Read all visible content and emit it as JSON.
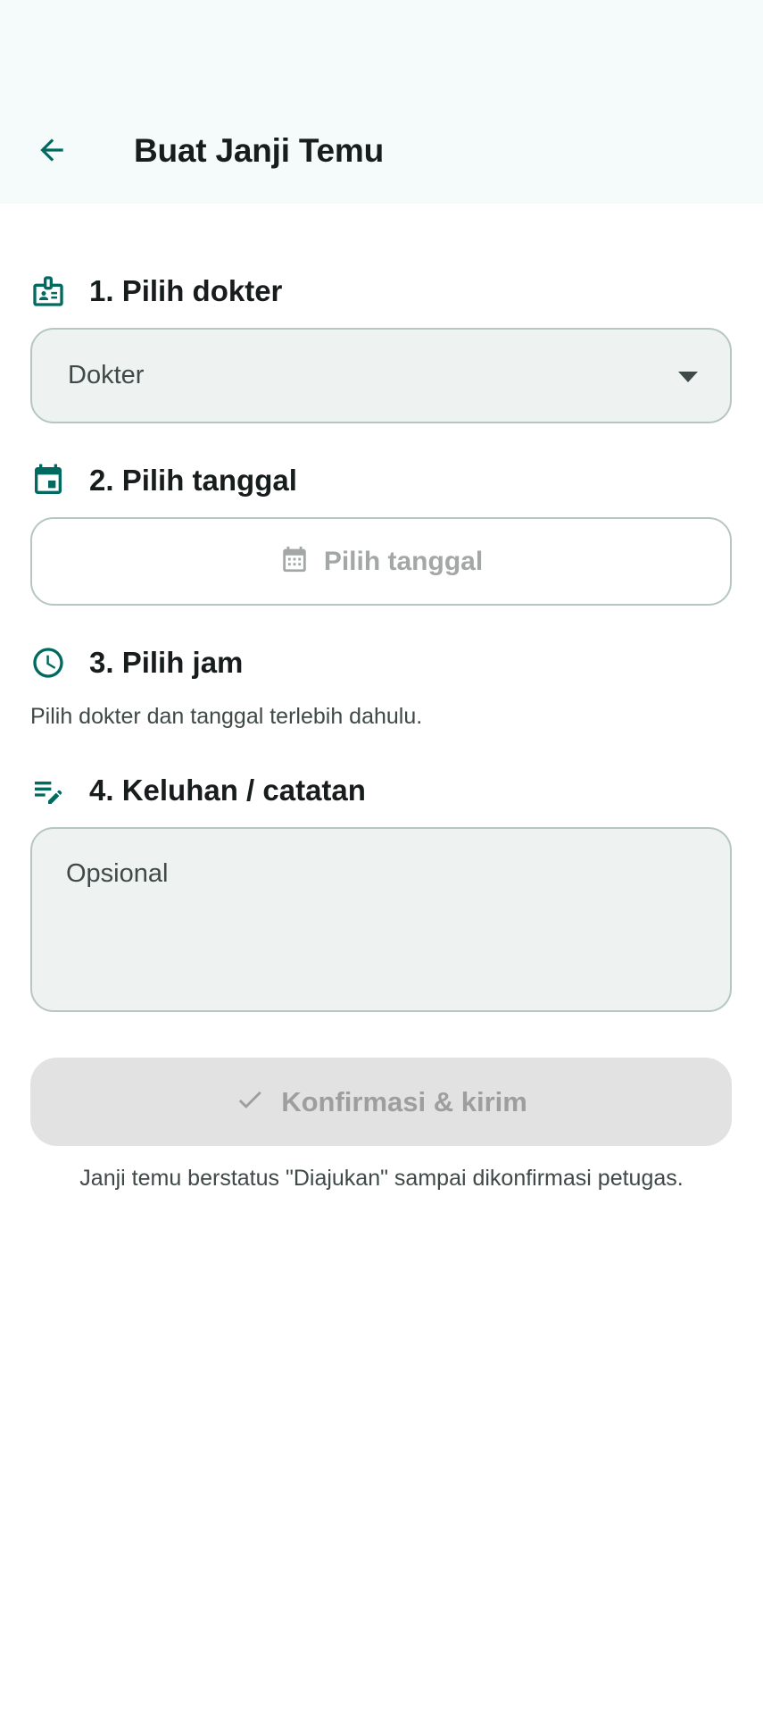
{
  "header": {
    "title": "Buat Janji Temu",
    "back_icon": "arrow-back-icon"
  },
  "colors": {
    "accent": "#006a60",
    "app_bar_bg": "#f4fbfa",
    "field_bg": "#eef3f2",
    "disabled_button_bg": "#e2e2e2",
    "disabled_text": "#9e9e9e"
  },
  "sections": {
    "doctor": {
      "icon": "badge-icon",
      "title": "1. Pilih dokter",
      "dropdown_value": "Dokter"
    },
    "date": {
      "icon": "event-icon",
      "title": "2. Pilih tanggal",
      "button_icon": "calendar-icon",
      "button_label": "Pilih tanggal"
    },
    "time": {
      "icon": "clock-icon",
      "title": "3. Pilih jam",
      "hint": "Pilih dokter dan tanggal terlebih dahulu."
    },
    "notes": {
      "icon": "edit-note-icon",
      "title": "4. Keluhan / catatan",
      "placeholder": "Opsional"
    }
  },
  "submit": {
    "icon": "check-icon",
    "label": "Konfirmasi & kirim",
    "note": "Janji temu berstatus \"Diajukan\" sampai dikonfirmasi petugas."
  }
}
